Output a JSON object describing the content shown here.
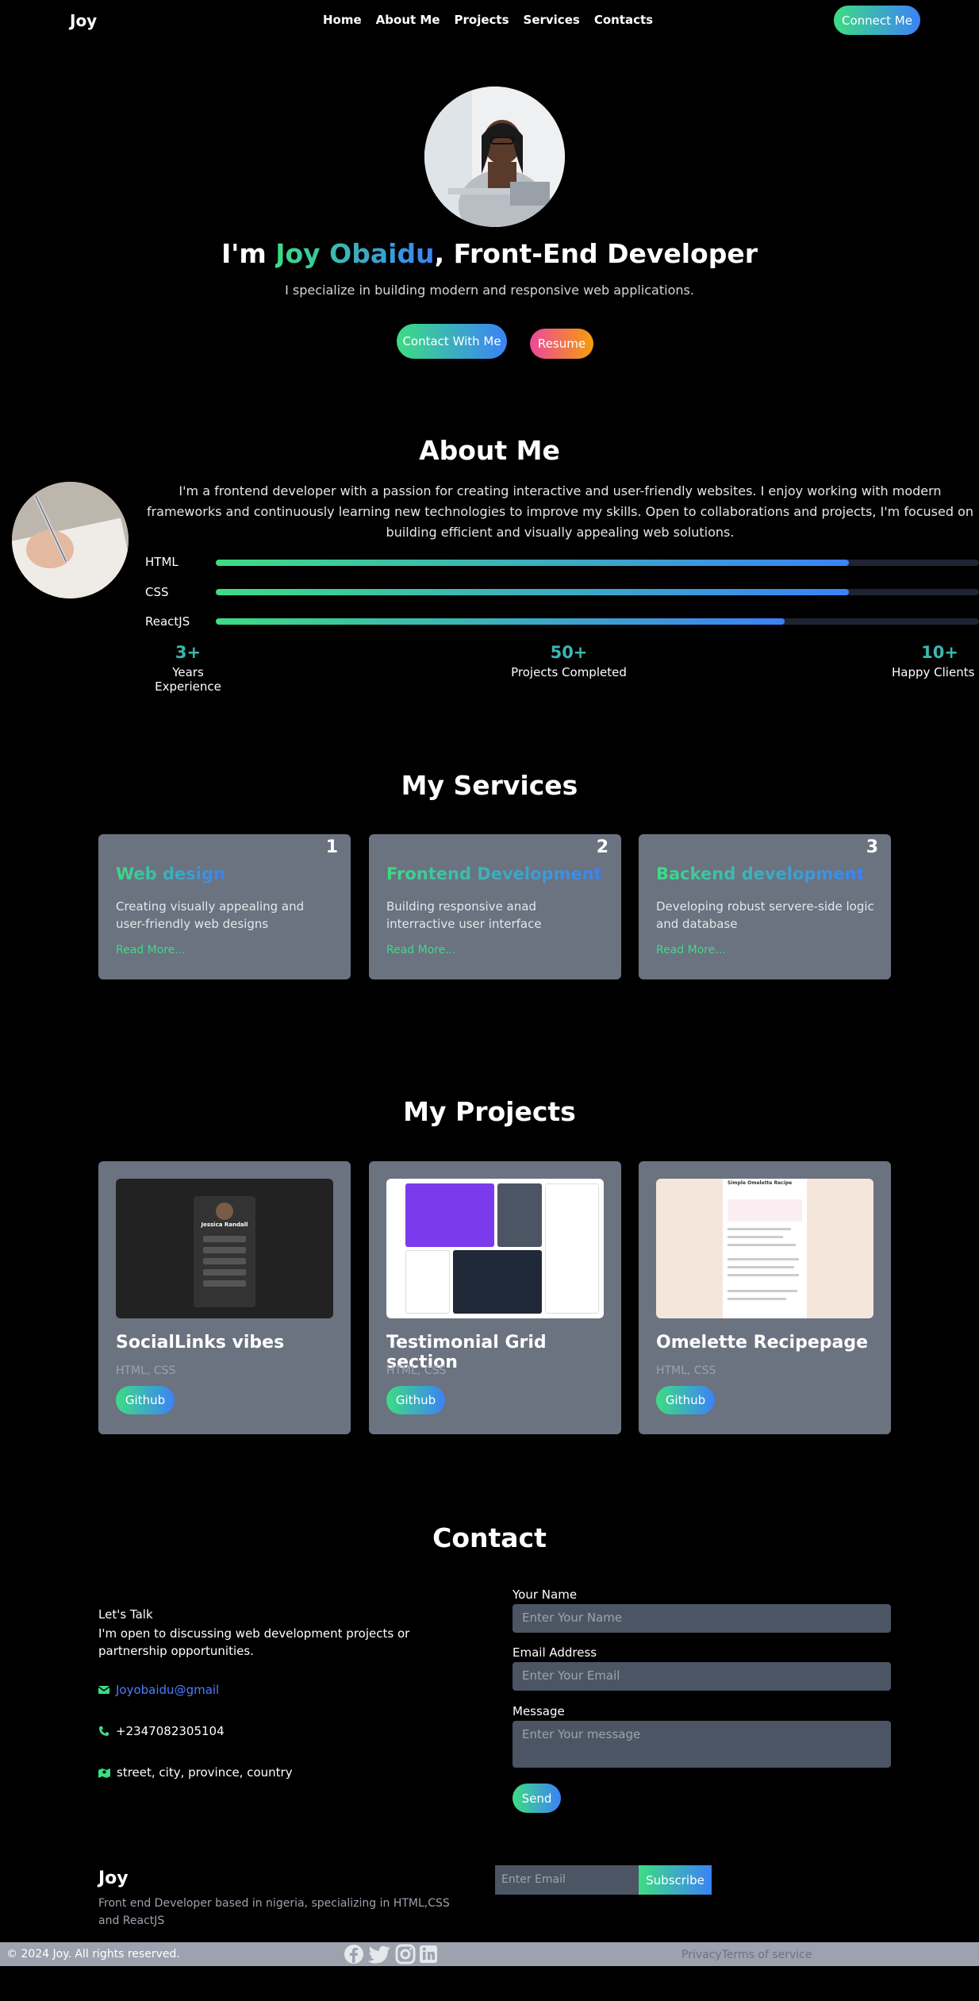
{
  "nav": {
    "logo": "Joy",
    "links": [
      "Home",
      "About Me",
      "Projects",
      "Services",
      "Contacts"
    ],
    "cta": "Connect Me"
  },
  "hero": {
    "prefix": "I'm ",
    "name": "Joy Obaidu",
    "suffix": ", Front-End Developer",
    "subtitle": "I specialize in building modern and responsive web applications.",
    "btn_contact": "Contact With Me",
    "btn_resume": "Resume"
  },
  "about": {
    "title": "About Me",
    "text": "I'm a frontend developer with a passion for creating interactive and user-friendly websites. I enjoy working with modern frameworks and continuously learning new technologies to improve my skills. Open to collaborations and projects, I'm focused on building efficient and visually appealing web solutions.",
    "skills": [
      {
        "name": "HTML",
        "level": 0.83
      },
      {
        "name": "CSS",
        "level": 0.83
      },
      {
        "name": "ReactJS",
        "level": 0.745
      }
    ],
    "stats": [
      {
        "value": "3+",
        "label": "Years Experience"
      },
      {
        "value": "50+",
        "label": "Projects Completed"
      },
      {
        "value": "10+",
        "label": "Happy Clients"
      }
    ]
  },
  "services": {
    "title": "My Services",
    "items": [
      {
        "num": "1",
        "title": "Web design",
        "desc": "Creating visually appealing and user-friendly web designs",
        "more": "Read More..."
      },
      {
        "num": "2",
        "title": "Frontend Development",
        "desc": "Building responsive anad interractive user interface",
        "more": "Read More..."
      },
      {
        "num": "3",
        "title": "Backend development",
        "desc": "Developing robust servere-side logic and database",
        "more": "Read More..."
      }
    ]
  },
  "projects": {
    "title": "My Projects",
    "items": [
      {
        "title": "SocialLinks vibes",
        "tech": "HTML, CSS",
        "btn": "Github",
        "thumb_title": "Jessica Randall"
      },
      {
        "title": "Testimonial Grid section",
        "tech": "HTML, CSS",
        "btn": "Github"
      },
      {
        "title": "Omelette Recipepage",
        "tech": "HTML, CSS",
        "btn": "Github",
        "thumb_title": "Simple Omelette Recipe"
      }
    ]
  },
  "contact": {
    "title": "Contact",
    "talk_title": "Let's Talk",
    "talk_text": "I'm open to discussing web development projects or partnership opportunities.",
    "email": "Joyobaidu@gmail",
    "phone": "+2347082305104",
    "address": "street, city, province, country",
    "form": {
      "name_label": "Your Name",
      "name_placeholder": "Enter Your Name",
      "email_label": "Email Address",
      "email_placeholder": "Enter Your Email",
      "message_label": "Message",
      "message_placeholder": "Enter Your message",
      "send": "Send"
    }
  },
  "footer": {
    "logo": "Joy",
    "desc": "Front end Developer based in nigeria, specializing in HTML,CSS and ReactJS",
    "email_placeholder": "Enter Email",
    "subscribe": "Subscribe",
    "copyright": "© 2024 Joy. All rights reserved.",
    "privacy": "Privacy",
    "terms": "Terms of service",
    "social_icons": [
      "facebook-icon",
      "twitter-icon",
      "instagram-icon",
      "linkedin-icon"
    ]
  },
  "colors": {
    "accent_green": "#3ddc84",
    "accent_blue": "#3b82f6",
    "card_bg": "#6b7280",
    "stat_teal": "#3ab8b0"
  }
}
